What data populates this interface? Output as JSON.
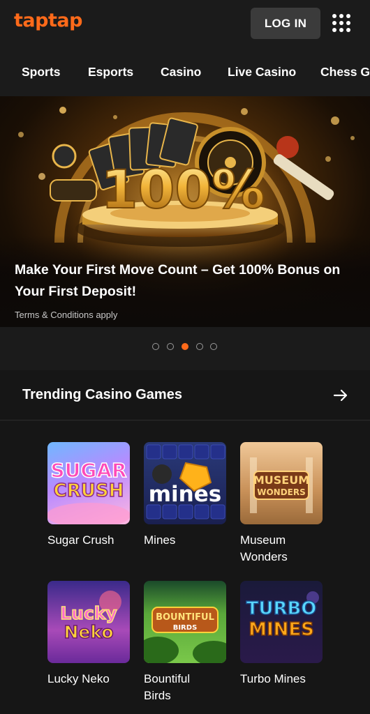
{
  "header": {
    "logo_text": "taptap",
    "login_label": "LOG IN",
    "menu_icon": "grid-menu-icon"
  },
  "nav": {
    "items": [
      "Sports",
      "Esports",
      "Casino",
      "Live Casino",
      "Chess Ga"
    ]
  },
  "banner": {
    "headline": "Make Your First Move Count – Get 100% Bonus on Your First Deposit!",
    "terms": "Terms & Conditions apply",
    "graphic_text": "100%",
    "slide_count": 5,
    "active_slide": 3
  },
  "section": {
    "title": "Trending Casino Games",
    "arrow_icon": "arrow-right-icon"
  },
  "games": [
    {
      "name": "Sugar Crush",
      "art_text": [
        "SUGAR",
        "CRUSH"
      ]
    },
    {
      "name": "Mines",
      "art_text": [
        "mines"
      ]
    },
    {
      "name": "Museum Wonders",
      "name_lines": [
        "Museum",
        "Wonders"
      ],
      "art_text": [
        "MUSEUM",
        "WONDERS"
      ]
    },
    {
      "name": "Lucky Neko",
      "art_text": [
        "Lucky",
        "Neko"
      ]
    },
    {
      "name": "Bountiful Birds",
      "name_lines": [
        "Bountiful",
        "Birds"
      ],
      "art_text": [
        "BOUNTIFUL",
        "BIRDS"
      ]
    },
    {
      "name": "Turbo Mines",
      "art_text": [
        "TURBO",
        "MINES"
      ]
    }
  ],
  "colors": {
    "accent": "#ff6a1a",
    "background": "#1a1a1a",
    "button": "#3b3b3b"
  }
}
